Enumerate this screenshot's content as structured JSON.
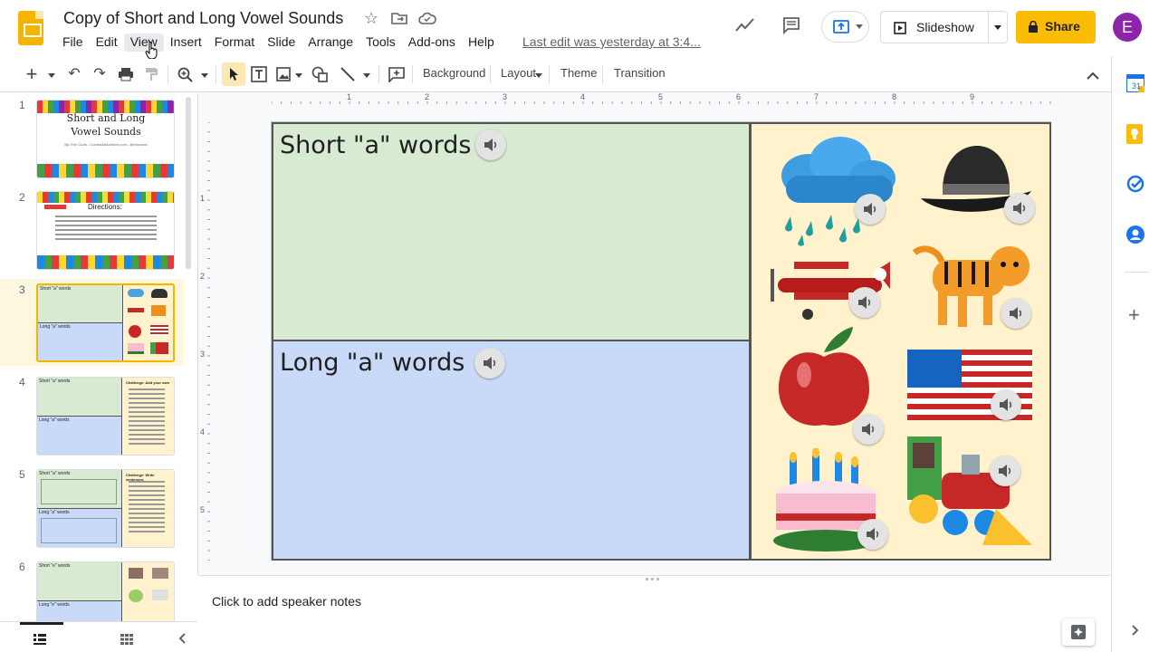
{
  "doc": {
    "title": "Copy of Short and Long Vowel Sounds",
    "last_edit": "Last edit was yesterday at 3:4..."
  },
  "menu": [
    "File",
    "Edit",
    "View",
    "Insert",
    "Format",
    "Slide",
    "Arrange",
    "Tools",
    "Add-ons",
    "Help"
  ],
  "header": {
    "slideshow_label": "Slideshow",
    "share_label": "Share",
    "avatar_letter": "E"
  },
  "toolbar": {
    "background": "Background",
    "layout": "Layout",
    "theme": "Theme",
    "transition": "Transition"
  },
  "ruler": {
    "h": [
      "1",
      "2",
      "3",
      "4",
      "5",
      "6",
      "7",
      "8",
      "9"
    ],
    "v": [
      "1",
      "2",
      "3",
      "4",
      "5"
    ]
  },
  "filmstrip": {
    "selected": 3,
    "slides": [
      {
        "num": "1",
        "title": "Short and Long Vowel Sounds",
        "credit": "By: Eric Curts - ControlAltAchieve.com - @ericcurts"
      },
      {
        "num": "2",
        "title": "Directions:"
      },
      {
        "num": "3",
        "a": "Short \"a\" words",
        "b": "Long \"a\" words"
      },
      {
        "num": "4",
        "a": "Short \"a\" words",
        "b": "Long \"a\" words",
        "side": "Challenge: Add your own"
      },
      {
        "num": "5",
        "a": "Short \"a\" words",
        "b": "Long \"a\" words",
        "side": "Challenge: Write sentences"
      },
      {
        "num": "6",
        "a": "Short \"e\" words",
        "b": "Long \"e\" words"
      }
    ]
  },
  "slide": {
    "short_label": "Short \"a\" words",
    "long_label": "Long \"a\" words",
    "pictures": [
      "rain-cloud",
      "fedora-hat",
      "airplane",
      "tiger",
      "apple",
      "flag",
      "cake",
      "train"
    ]
  },
  "notes": {
    "placeholder": "Click to add speaker notes"
  },
  "colors": {
    "short_bg": "#d9ead3",
    "long_bg": "#c9daf8",
    "pics_bg": "#fff2cc",
    "share": "#fbbc04",
    "accent": "#f4b400"
  }
}
